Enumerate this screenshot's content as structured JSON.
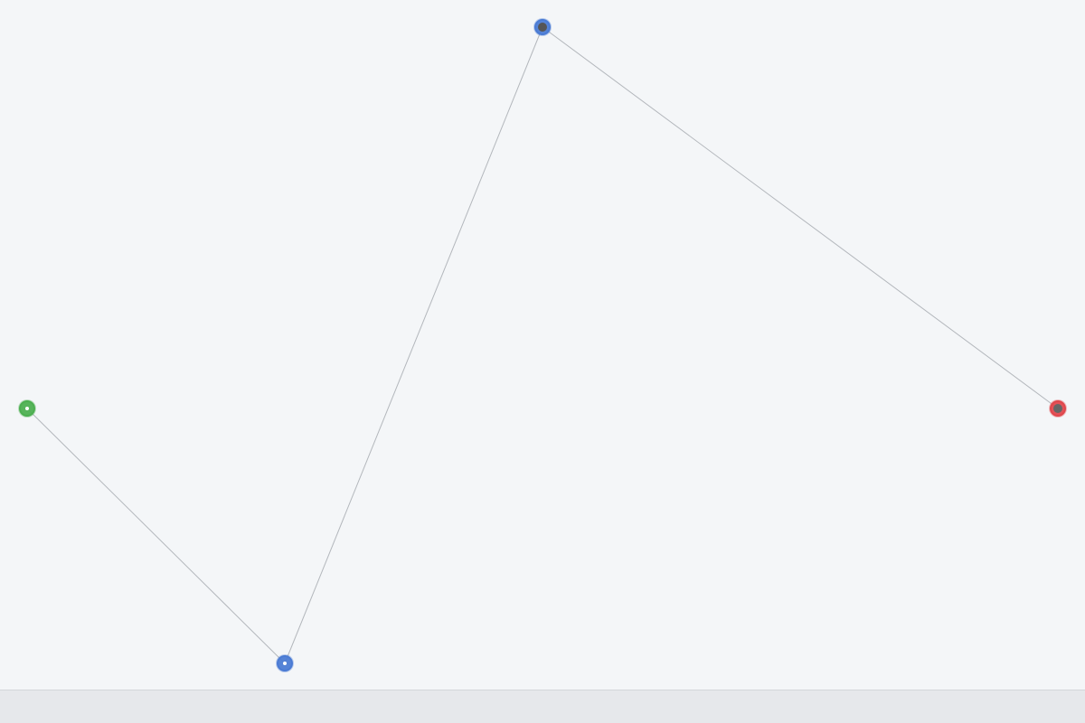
{
  "nodes": [
    {
      "id": "start",
      "color": "#4caf50",
      "center": "dot",
      "center_color": "#ffffff"
    },
    {
      "id": "bottom",
      "color": "#4a7bd4",
      "center": "dot",
      "center_color": "#ffffff"
    },
    {
      "id": "top",
      "color": "#4a7bd4",
      "center": "core",
      "center_color": "#555555"
    },
    {
      "id": "end",
      "color": "#e0474c",
      "center": "core",
      "center_color": "#666666"
    }
  ],
  "edges": [
    {
      "from": "start",
      "to": "bottom"
    },
    {
      "from": "bottom",
      "to": "top"
    },
    {
      "from": "top",
      "to": "end"
    }
  ],
  "colors": {
    "background": "#f4f6f8",
    "edge": "#b3b7bc",
    "bottom_bar": "#e6e8eb"
  }
}
